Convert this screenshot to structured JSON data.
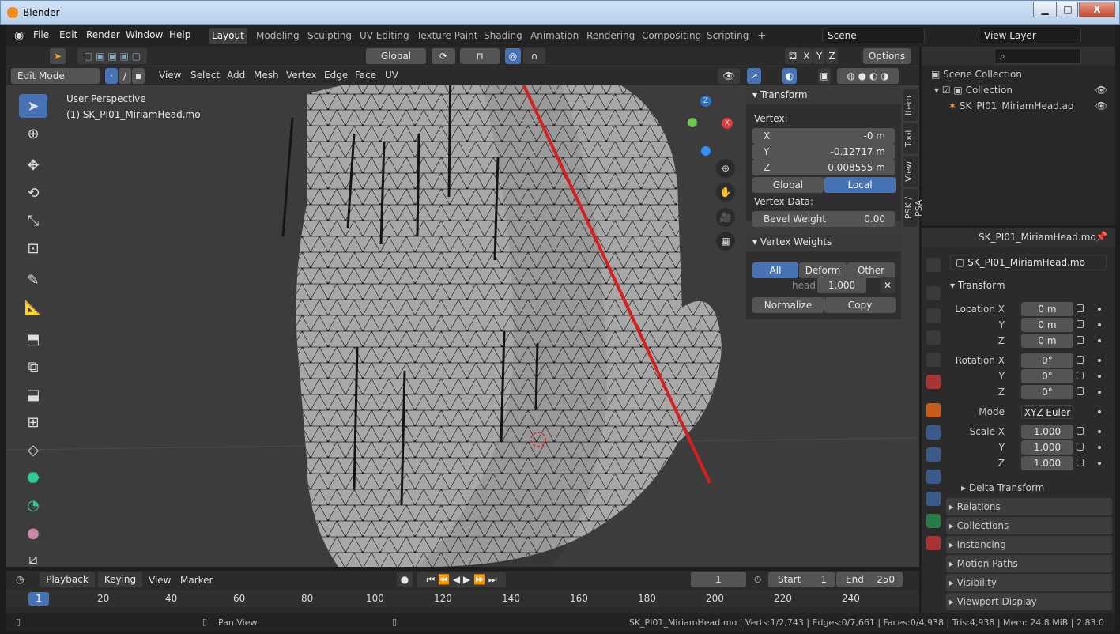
{
  "window": {
    "title": "Blender",
    "minimize": "▁",
    "maximize": "□",
    "close": "X"
  },
  "menu": [
    "File",
    "Edit",
    "Render",
    "Window",
    "Help"
  ],
  "workspaces": [
    "Layout",
    "Modeling",
    "Sculpting",
    "UV Editing",
    "Texture Paint",
    "Shading",
    "Animation",
    "Rendering",
    "Compositing",
    "Scripting"
  ],
  "add_workspace": "+",
  "scene": {
    "label": "Scene",
    "view_layer": "View Layer"
  },
  "viewport_header": {
    "orientation": "Global",
    "options": "Options",
    "axes": [
      "X",
      "Y",
      "Z"
    ],
    "mode": "Edit Mode",
    "menus": [
      "View",
      "Select",
      "Add",
      "Mesh",
      "Vertex",
      "Edge",
      "Face",
      "UV"
    ]
  },
  "viewport": {
    "perspective": "User Perspective",
    "object": "(1) SK_PI01_MiriamHead.mo",
    "gizmo": {
      "z": "Z",
      "x": "X",
      "y": "Y"
    }
  },
  "npanel": {
    "tabs": [
      "Item",
      "Tool",
      "View",
      "PSK / PSA"
    ],
    "transform": {
      "title": "Transform",
      "vertex_label": "Vertex:",
      "x_label": "X",
      "x": "-0 m",
      "y_label": "Y",
      "y": "-0.12717 m",
      "z_label": "Z",
      "z": "0.008555 m",
      "global": "Global",
      "local": "Local",
      "vertex_data": "Vertex Data:",
      "bevel_label": "Bevel Weight",
      "bevel": "0.00"
    },
    "weights": {
      "title": "Vertex Weights",
      "all": "All",
      "deform": "Deform",
      "other": "Other",
      "group": "head",
      "value": "1.000",
      "normalize": "Normalize",
      "copy": "Copy"
    }
  },
  "outliner": {
    "scene_collection": "Scene Collection",
    "collection": "Collection",
    "object": "SK_PI01_MiriamHead.ao"
  },
  "properties": {
    "object_name": "SK_PI01_MiriamHead.mo",
    "data_name": "SK_PI01_MiriamHead.mo",
    "transform": "Transform",
    "location_label": "Location X",
    "loc": [
      "0 m",
      "0 m",
      "0 m"
    ],
    "rotation_label": "Rotation X",
    "rot": [
      "0°",
      "0°",
      "0°"
    ],
    "y_label": "Y",
    "z_label": "Z",
    "mode_label": "Mode",
    "mode": "XYZ Euler",
    "scale_label": "Scale X",
    "scale": [
      "1.000",
      "1.000",
      "1.000"
    ],
    "delta": "Delta Transform",
    "sections": [
      "Relations",
      "Collections",
      "Instancing",
      "Motion Paths",
      "Visibility",
      "Viewport Display"
    ]
  },
  "timeline": {
    "playback": "Playback",
    "keying": "Keying",
    "view": "View",
    "marker": "Marker",
    "current": "1",
    "start_label": "Start",
    "start": "1",
    "end_label": "End",
    "end": "250",
    "ruler": [
      "1",
      "20",
      "40",
      "60",
      "80",
      "100",
      "120",
      "140",
      "160",
      "180",
      "200",
      "220",
      "240"
    ]
  },
  "status": {
    "pan": "Pan View",
    "info": "SK_PI01_MiriamHead.mo | Verts:1/2,743 | Edges:0/7,661 | Faces:0/4,938 | Tris:4,938 | Mem: 24.8 MiB | 2.83.0"
  }
}
